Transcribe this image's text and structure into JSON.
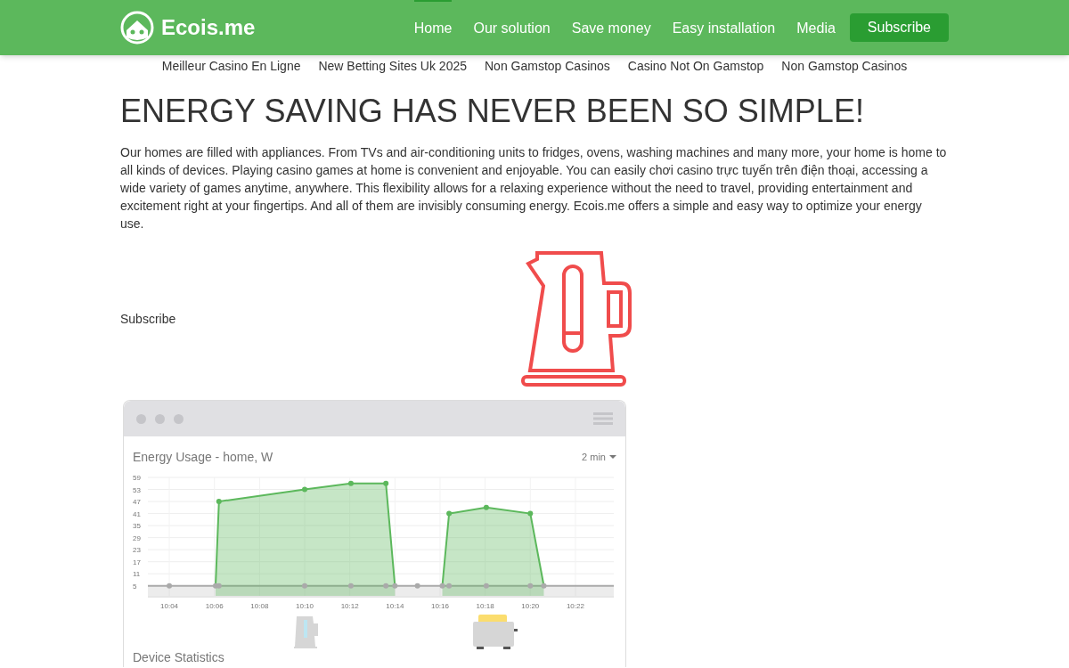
{
  "header": {
    "logo": "Ecois.me",
    "nav": [
      {
        "label": "Home",
        "selected": true
      },
      {
        "label": "Our solution",
        "selected": false
      },
      {
        "label": "Save money",
        "selected": false
      },
      {
        "label": "Easy installation",
        "selected": false
      },
      {
        "label": "Media",
        "selected": false
      }
    ],
    "subscribe_button": "Subscribe"
  },
  "links": [
    "Meilleur Casino En Ligne",
    "New Betting Sites Uk 2025",
    "Non Gamstop Casinos",
    "Casino Not On Gamstop",
    "Non Gamstop Casinos"
  ],
  "heading": "ENERGY SAVING HAS NEVER BEEN SO SIMPLE!",
  "intro": "Our homes are filled with appliances. From TVs and air-conditioning units to fridges, ovens, washing machines and many more, your home is home to all kinds of devices. Playing casino games at home is convenient and enjoyable. You can easily chơi casino trực tuyến trên điện thoại, accessing a wide variety of games anytime, anywhere. This flexibility allows for a relaxing experience without the need to travel, providing entertainment and excitement right at your fingertips. And all of them are invisibly consuming energy. Ecois.me offers a simple and easy way to optimize your energy use.",
  "subscribe_label": "Subscribe",
  "app": {
    "title": "Energy Usage - home, W",
    "range": "2 min",
    "chart_data": {
      "type": "area",
      "grid": true,
      "x": [
        603.05,
        604,
        606.05,
        606.2,
        610,
        612.05,
        613.6,
        614,
        615,
        616.1,
        616.4,
        618.05,
        620,
        620.6,
        623.7
      ],
      "series": [
        {
          "color": "#aaaaaa",
          "values": [
            5,
            5,
            5,
            5,
            5,
            5,
            5,
            5,
            5,
            5,
            5,
            5,
            5,
            5,
            5
          ]
        },
        {
          "color": "#5cb85c",
          "values": [
            null,
            null,
            5,
            47,
            53,
            56,
            56,
            5,
            null,
            5,
            41,
            44,
            41,
            5,
            null
          ]
        }
      ],
      "xlim": [
        603.05,
        623.7
      ],
      "ylim": [
        0,
        59
      ],
      "xticks": [
        {
          "value": 604,
          "label": "10:04"
        },
        {
          "value": 606,
          "label": "10:06"
        },
        {
          "value": 608,
          "label": "10:08"
        },
        {
          "value": 610,
          "label": "10:10"
        },
        {
          "value": 612,
          "label": "10:12"
        },
        {
          "value": 614,
          "label": "10:14"
        },
        {
          "value": 616,
          "label": "10:16"
        },
        {
          "value": 618,
          "label": "10:18"
        },
        {
          "value": 620,
          "label": "10:20"
        },
        {
          "value": 622,
          "label": "10:22"
        }
      ],
      "yticks": [
        5,
        11,
        17,
        23,
        29,
        35,
        41,
        47,
        53,
        59
      ]
    },
    "devices": [
      {
        "kind": "kettle"
      },
      {
        "kind": "toaster"
      }
    ],
    "stats_title": "Device Statistics"
  }
}
